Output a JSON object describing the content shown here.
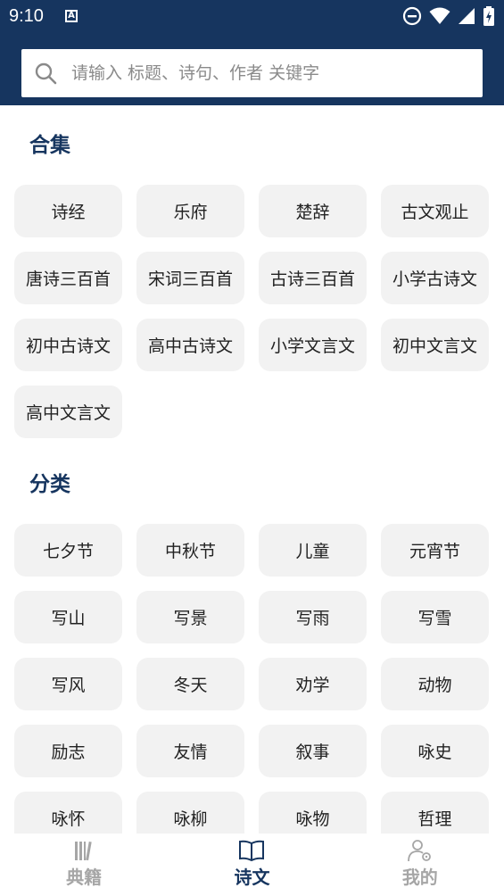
{
  "status_bar": {
    "time": "9:10"
  },
  "search": {
    "placeholder": "请输入 标题、诗句、作者 关键字"
  },
  "sections": {
    "collections": {
      "title": "合集",
      "items": [
        "诗经",
        "乐府",
        "楚辞",
        "古文观止",
        "唐诗三百首",
        "宋词三百首",
        "古诗三百首",
        "小学古诗文",
        "初中古诗文",
        "高中古诗文",
        "小学文言文",
        "初中文言文",
        "高中文言文"
      ]
    },
    "categories": {
      "title": "分类",
      "items": [
        "七夕节",
        "中秋节",
        "儿童",
        "元宵节",
        "写山",
        "写景",
        "写雨",
        "写雪",
        "写风",
        "冬天",
        "劝学",
        "动物",
        "励志",
        "友情",
        "叙事",
        "咏史",
        "咏怀",
        "咏柳",
        "咏物",
        "哲理"
      ]
    }
  },
  "bottom_nav": {
    "items": [
      {
        "label": "典籍",
        "icon": "books-icon",
        "active": false
      },
      {
        "label": "诗文",
        "icon": "open-book-icon",
        "active": true
      },
      {
        "label": "我的",
        "icon": "user-settings-icon",
        "active": false
      }
    ]
  },
  "colors": {
    "primary": "#16355f",
    "chip_bg": "#f2f2f2",
    "inactive": "#a6a6a6"
  }
}
